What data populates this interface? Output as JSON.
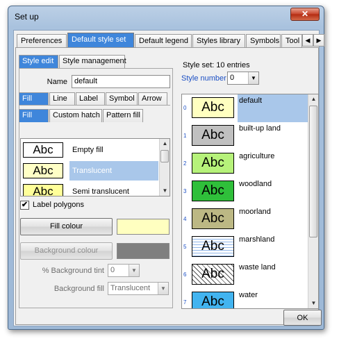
{
  "window": {
    "title": "Set up",
    "close_label": "✕"
  },
  "tabs": [
    {
      "label": "Preferences"
    },
    {
      "label": "Default style set"
    },
    {
      "label": "Default legend"
    },
    {
      "label": "Styles library"
    },
    {
      "label": "Symbols"
    },
    {
      "label": "Tool"
    }
  ],
  "tab_scroll": {
    "left": "◀",
    "right": "▶"
  },
  "style_tabs": [
    {
      "label": "Style edit"
    },
    {
      "label": "Style management"
    }
  ],
  "name_field": {
    "label": "Name",
    "value": "default"
  },
  "prop_tabs": [
    {
      "label": "Fill"
    },
    {
      "label": "Line"
    },
    {
      "label": "Label"
    },
    {
      "label": "Symbol"
    },
    {
      "label": "Arrow"
    }
  ],
  "fill_tabs": [
    {
      "label": "Fill"
    },
    {
      "label": "Custom hatch"
    },
    {
      "label": "Pattern fill"
    }
  ],
  "fill_types": [
    {
      "swatch": "Abc",
      "label": "Empty fill",
      "color": "#ffffff"
    },
    {
      "swatch": "Abc",
      "label": "Translucent",
      "color": "#ffffc6"
    },
    {
      "swatch": "Abc",
      "label": "Semi translucent",
      "color": "#ffff99"
    }
  ],
  "label_polygons": {
    "label": "Label polygons",
    "checked": "✔"
  },
  "fill_colour_button": "Fill colour",
  "fill_colour_value": "#ffffc0",
  "background_colour_button": "Background colour",
  "background_colour_value": "#7f7f7f",
  "background_tint": {
    "label": "% Background tint",
    "value": "0"
  },
  "background_fill": {
    "label": "Background fill",
    "value": "Translucent"
  },
  "style_set": {
    "title": "Style set: 10 entries",
    "number_label": "Style number",
    "number_value": "0"
  },
  "styles": [
    {
      "num": "0",
      "swatch": "Abc",
      "name": "default",
      "color": "#ffffc0"
    },
    {
      "num": "1",
      "swatch": "Abc",
      "name": "built-up land",
      "color": "#c0c0c0"
    },
    {
      "num": "2",
      "swatch": "Abc",
      "name": "agriculture",
      "color": "#b6f27a"
    },
    {
      "num": "3",
      "swatch": "Abc",
      "name": "woodland",
      "color": "#2fbf3a"
    },
    {
      "num": "4",
      "swatch": "Abc",
      "name": "moorland",
      "color": "#bcb884"
    },
    {
      "num": "5",
      "swatch": "Abc",
      "name": "marshland",
      "color": "#ffffff"
    },
    {
      "num": "6",
      "swatch": "Abc",
      "name": "waste land",
      "color": "#ffffff"
    },
    {
      "num": "7",
      "swatch": "Abc",
      "name": "water",
      "color": "#42b4f0"
    }
  ],
  "ok_button": "OK"
}
